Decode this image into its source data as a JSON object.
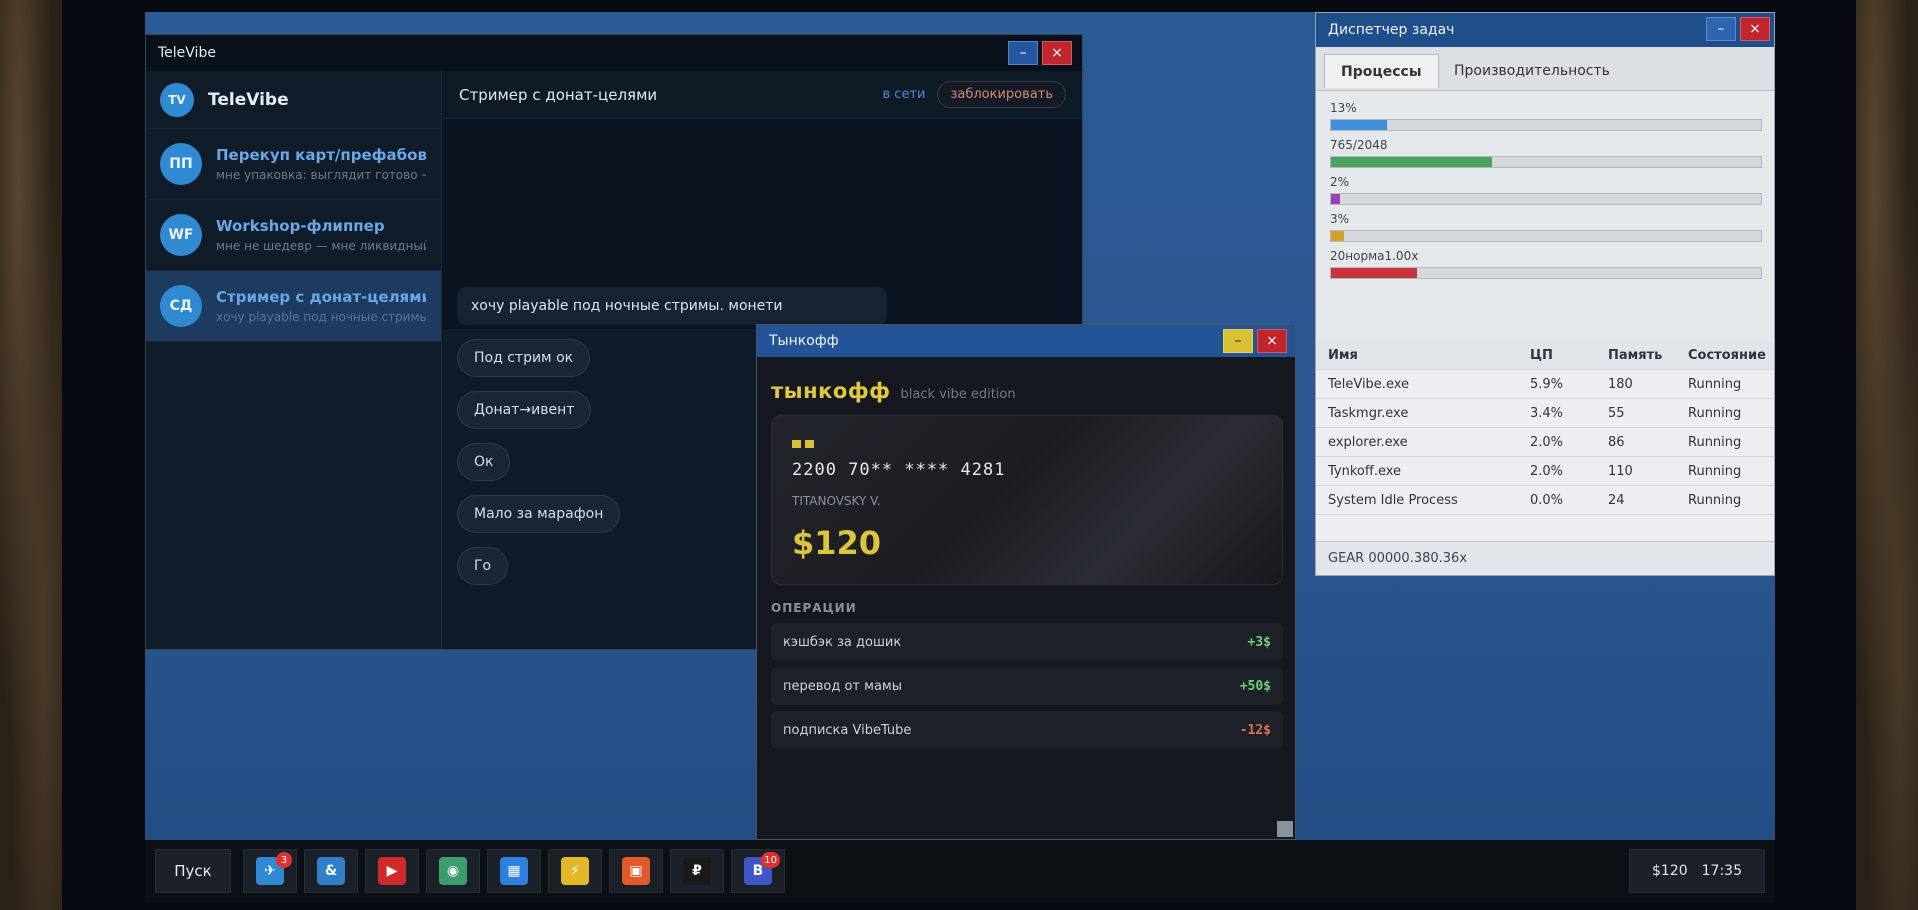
{
  "televibe": {
    "window_title": "TeleVibe",
    "brand_initials": "TV",
    "brand_name": "TeleVibe",
    "chats": [
      {
        "initials": "ПП",
        "title": "Перекуп карт/префабов",
        "preview": "мне упаковка: выглядит готово →"
      },
      {
        "initials": "WF",
        "title": "Workshop-флиппер",
        "preview": "мне не шедевр — мне ликвидный"
      },
      {
        "initials": "СД",
        "title": "Стример с донат-целями",
        "preview": "хочу playable под ночные стримы"
      }
    ],
    "header": {
      "title": "Стример с донат-целями",
      "status": "в сети",
      "block_label": "заблокировать"
    },
    "message": "хочу playable под ночные стримы. монети",
    "replies": [
      "Под стрим ок",
      "Донат→ивент",
      "Ок",
      "Мало за марафон",
      "Го"
    ]
  },
  "taskmgr": {
    "window_title": "Диспетчер задач",
    "tabs": [
      "Процессы",
      "Производительность"
    ],
    "perf": [
      {
        "label": "13%",
        "fraction": 0.13,
        "color": "#3c8fd8"
      },
      {
        "label": "765/2048",
        "fraction": 0.3735,
        "color": "#4aa35a"
      },
      {
        "label": "2%",
        "fraction": 0.02,
        "color": "#9b3fb8"
      },
      {
        "label": "3%",
        "fraction": 0.03,
        "color": "#d1a02c"
      },
      {
        "label": "20норма1.00x",
        "fraction": 0.2,
        "color": "#c8343a"
      }
    ],
    "columns": [
      "Имя",
      "ЦП",
      "Память",
      "Состояние"
    ],
    "rows": [
      [
        "TeleVibe.exe",
        "5.9%",
        "180",
        "Running"
      ],
      [
        "Taskmgr.exe",
        "3.4%",
        "55",
        "Running"
      ],
      [
        "explorer.exe",
        "2.0%",
        "86",
        "Running"
      ],
      [
        "Tynkoff.exe",
        "2.0%",
        "110",
        "Running"
      ],
      [
        "System Idle Process",
        "0.0%",
        "24",
        "Running"
      ]
    ],
    "status": "GEAR 00000.380.36x"
  },
  "tynkoff": {
    "window_title": "Тынкофф",
    "logo": "тынкофф",
    "edition": "black vibe edition",
    "card_number": "2200 70** **** 4281",
    "card_holder": "TITANOVSKY V.",
    "balance": "$120",
    "ops_title": "ОПЕРАЦИИ",
    "operations": [
      {
        "label": "кэшбэк за дошик",
        "amount": "+3$",
        "kind": "pos"
      },
      {
        "label": "перевод от мамы",
        "amount": "+50$",
        "kind": "pos"
      },
      {
        "label": "подписка VibeTube",
        "amount": "-12$",
        "kind": "neg"
      }
    ]
  },
  "window_buttons": {
    "minimize": "–",
    "close": "×"
  },
  "taskbar": {
    "start_label": "Пуск",
    "apps": [
      {
        "name": "telegram",
        "glyph": "✈",
        "color": "#2f8ad2",
        "badge": "3"
      },
      {
        "name": "ampersand",
        "glyph": "&",
        "color": "#2f7fc9",
        "badge": ""
      },
      {
        "name": "video",
        "glyph": "▶",
        "color": "#d02a2a",
        "badge": ""
      },
      {
        "name": "browser",
        "glyph": "◉",
        "color": "#3a9d6b",
        "badge": ""
      },
      {
        "name": "windows",
        "glyph": "▦",
        "color": "#2d7fe0",
        "badge": ""
      },
      {
        "name": "bolt",
        "glyph": "⚡",
        "color": "#e0b82a",
        "badge": ""
      },
      {
        "name": "gift",
        "glyph": "▣",
        "color": "#e2592a",
        "badge": ""
      },
      {
        "name": "ruble",
        "glyph": "₽",
        "color": "#1a1a1a",
        "badge": ""
      },
      {
        "name": "b-app",
        "glyph": "B",
        "color": "#4056c8",
        "badge": "10"
      }
    ],
    "balance": "$120",
    "time": "17:35"
  }
}
